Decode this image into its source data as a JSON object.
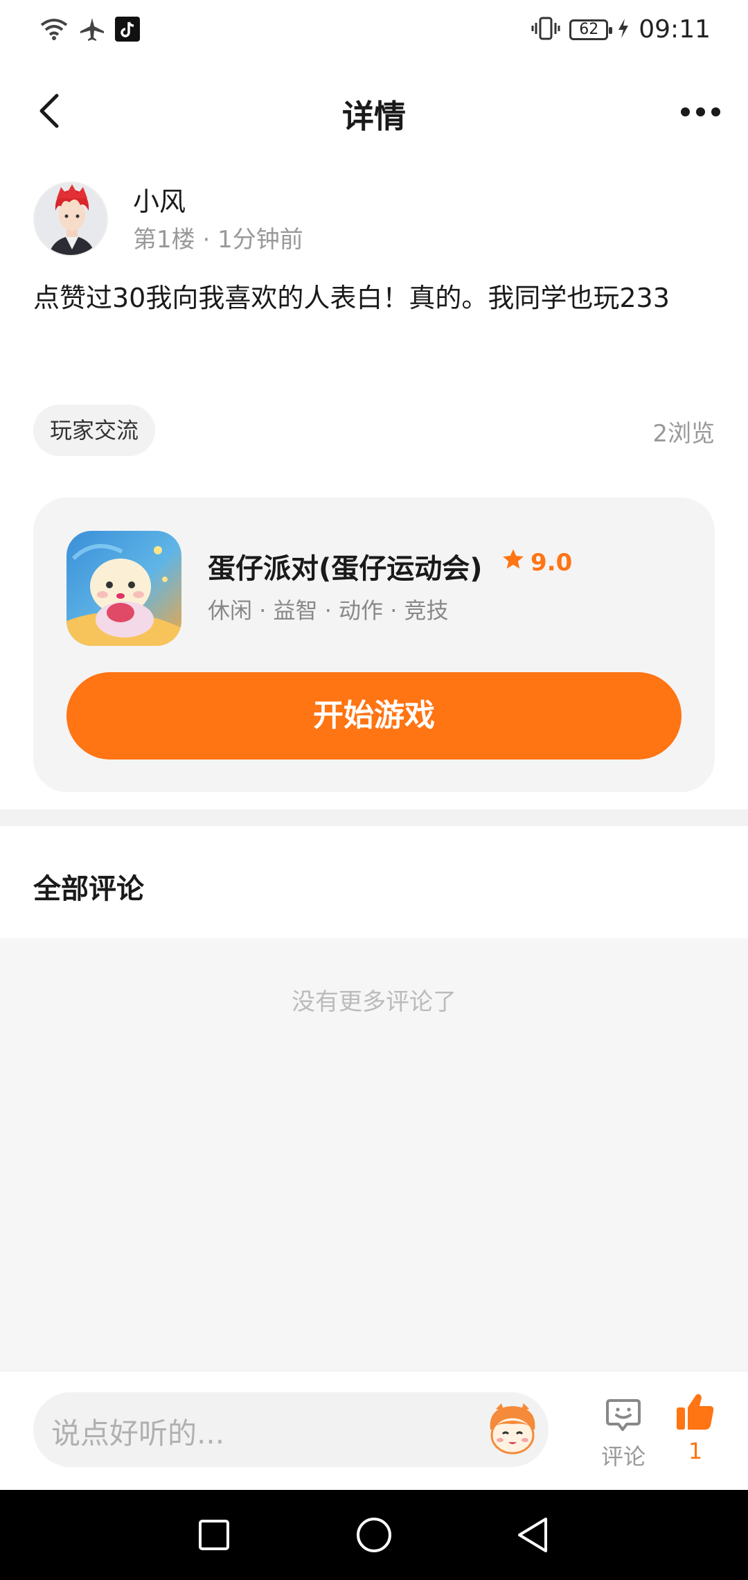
{
  "status_bar": {
    "time": "09:11",
    "battery": "62",
    "icons": [
      "wifi-icon",
      "airplane-icon",
      "tiktok-icon",
      "vibrate-icon",
      "charging-icon"
    ]
  },
  "header": {
    "title": "详情"
  },
  "post": {
    "username": "小风",
    "floor": "第1楼",
    "time_ago": "1分钟前",
    "content": "点赞过30我向我喜欢的人表白！真的。我同学也玩233",
    "tag": "玩家交流",
    "views": "2浏览"
  },
  "game": {
    "name": "蛋仔派对(蛋仔运动会)",
    "rating": "9.0",
    "genres": "休闲 · 益智 · 动作 · 竞技",
    "play_label": "开始游戏"
  },
  "comments": {
    "title": "全部评论",
    "empty_text": "没有更多评论了"
  },
  "bottom_bar": {
    "input_placeholder": "说点好听的...",
    "comment_label": "评论",
    "like_count": "1"
  },
  "colors": {
    "accent": "#ff7413",
    "card_bg": "#f4f4f4",
    "list_bg": "#f6f6f6"
  }
}
